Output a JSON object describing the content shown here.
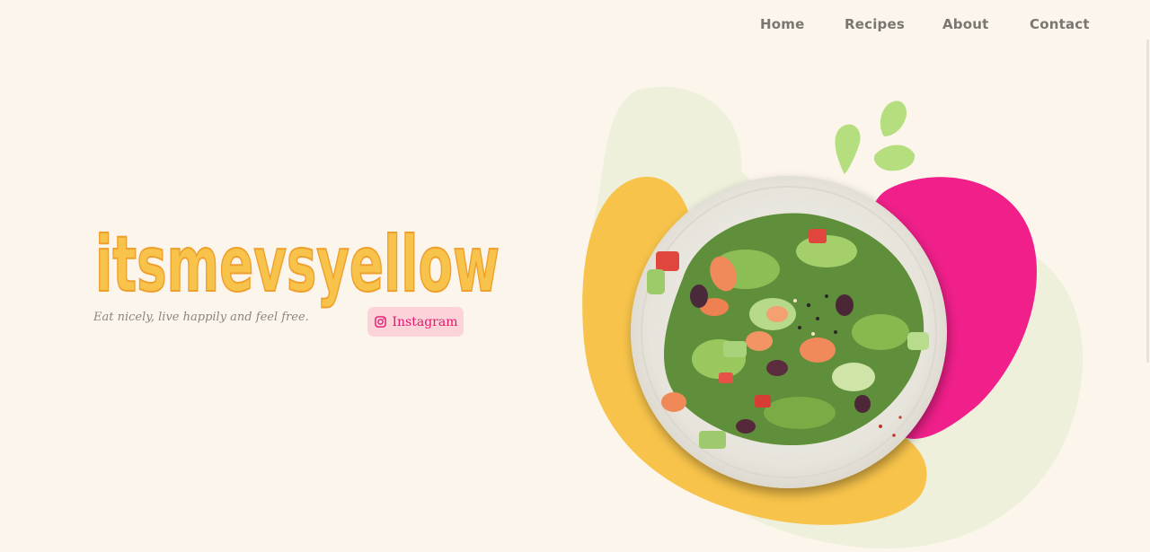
{
  "nav": {
    "items": [
      {
        "label": "Home"
      },
      {
        "label": "Recipes"
      },
      {
        "label": "About"
      },
      {
        "label": "Contact"
      }
    ]
  },
  "hero": {
    "brand_name": "itsmevsyellow",
    "tagline": "Eat nicely, live happily and feel free.",
    "instagram_label": "Instagram"
  },
  "theme": {
    "background": "#fcf5ec",
    "brand_yellow": "#f7c34a",
    "accent_pink": "#f01f8a",
    "leaf_green": "#b5de7f",
    "pale_green": "#eef0dc",
    "nav_text": "#7a7670"
  },
  "icons": {
    "instagram": "instagram-icon"
  }
}
